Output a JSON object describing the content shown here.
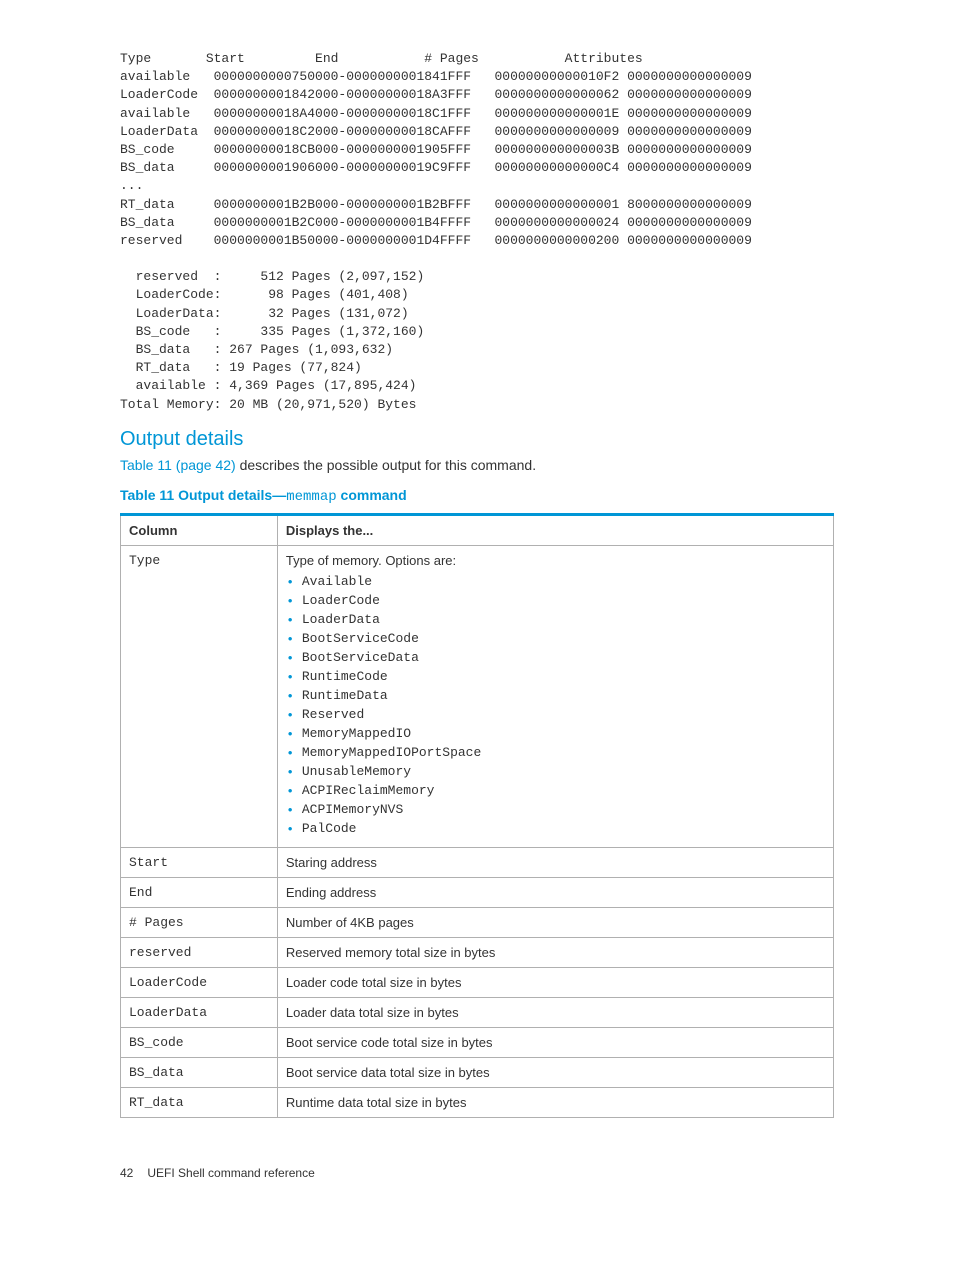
{
  "memmap_output": "Type       Start         End           # Pages           Attributes\navailable   0000000000750000-0000000001841FFF   00000000000010F2 0000000000000009\nLoaderCode  0000000001842000-00000000018A3FFF   0000000000000062 0000000000000009\navailable   00000000018A4000-00000000018C1FFF   000000000000001E 0000000000000009\nLoaderData  00000000018C2000-00000000018CAFFF   0000000000000009 0000000000000009\nBS_code     00000000018CB000-0000000001905FFF   000000000000003B 0000000000000009\nBS_data     0000000001906000-00000000019C9FFF   00000000000000C4 0000000000000009\n...\nRT_data     0000000001B2B000-0000000001B2BFFF   0000000000000001 8000000000000009\nBS_data     0000000001B2C000-0000000001B4FFFF   0000000000000024 0000000000000009\nreserved    0000000001B50000-0000000001D4FFFF   0000000000000200 0000000000000009\n\n  reserved  :     512 Pages (2,097,152)\n  LoaderCode:      98 Pages (401,408)\n  LoaderData:      32 Pages (131,072)\n  BS_code   :     335 Pages (1,372,160)\n  BS_data   : 267 Pages (1,093,632)\n  RT_data   : 19 Pages (77,824)\n  available : 4,369 Pages (17,895,424)\nTotal Memory: 20 MB (20,971,520) Bytes",
  "headings": {
    "output_details": "Output details"
  },
  "para": {
    "link_text": "Table 11 (page 42)",
    "rest": " describes the possible output for this command."
  },
  "table_title": {
    "prefix": "Table 11 Output details—",
    "cmd": "memmap",
    "suffix": " command"
  },
  "table": {
    "headers": {
      "col1": "Column",
      "col2": "Displays the..."
    },
    "rows": [
      {
        "col1": "Type",
        "intro": "Type of memory. Options are:",
        "options": [
          "Available",
          "LoaderCode",
          "LoaderData",
          "BootServiceCode",
          "BootServiceData",
          "RuntimeCode",
          "RuntimeData",
          "Reserved",
          "MemoryMappedIO",
          "MemoryMappedIOPortSpace",
          "UnusableMemory",
          "ACPIReclaimMemory",
          "ACPIMemoryNVS",
          "PalCode"
        ]
      },
      {
        "col1": "Start",
        "desc": "Staring address"
      },
      {
        "col1": "End",
        "desc": "Ending address"
      },
      {
        "col1": "# Pages",
        "desc": "Number of 4KB pages"
      },
      {
        "col1": "reserved",
        "desc": "Reserved memory total size in bytes"
      },
      {
        "col1": "LoaderCode",
        "desc": "Loader code total size in bytes"
      },
      {
        "col1": "LoaderData",
        "desc": "Loader data total size in bytes"
      },
      {
        "col1": "BS_code",
        "desc": "Boot service code total size in bytes"
      },
      {
        "col1": "BS_data",
        "desc": "Boot service data total size in bytes"
      },
      {
        "col1": "RT_data",
        "desc": "Runtime data total size in bytes"
      }
    ]
  },
  "footer": {
    "page": "42",
    "section": "UEFI Shell command reference"
  }
}
